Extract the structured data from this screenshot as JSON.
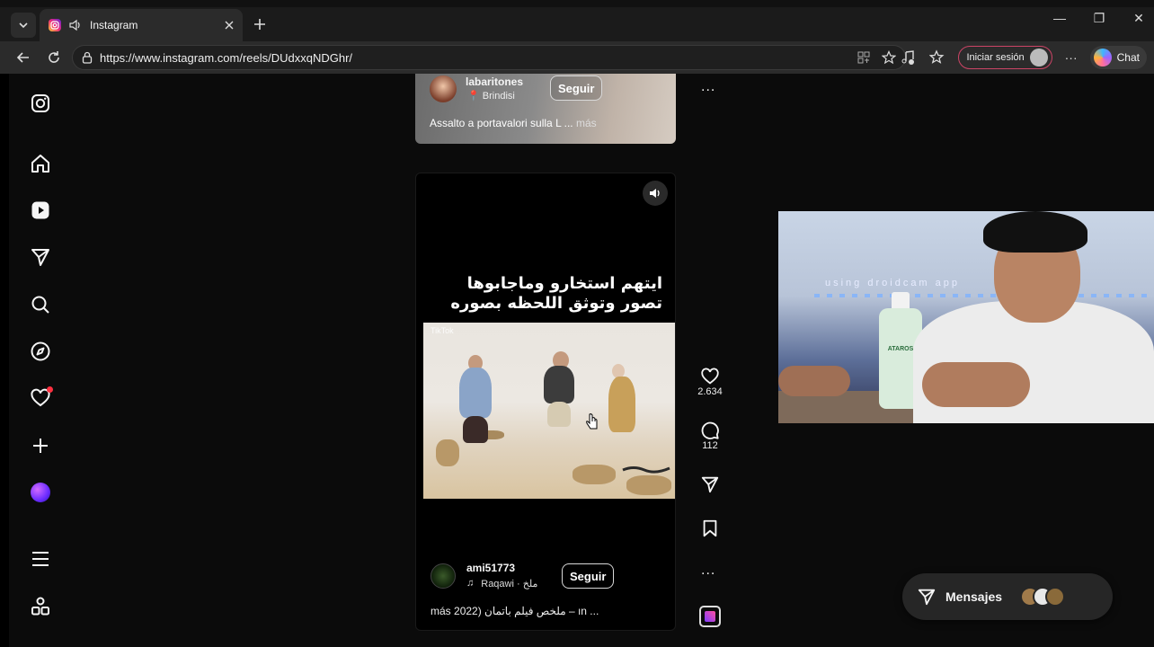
{
  "browser": {
    "tab_title": "Instagram",
    "url": "https://www.instagram.com/reels/DUdxxqNDGhr/",
    "signin_label": "Iniciar sesión",
    "chat_label": "Chat"
  },
  "sidebar": {
    "items": [
      "instagram-logo",
      "home",
      "reels",
      "messages",
      "search",
      "explore",
      "notifications",
      "create",
      "meta-ai",
      "more",
      "also-from-meta"
    ]
  },
  "prev_reel": {
    "username": "labaritones",
    "location": "Brindisi",
    "follow_label": "Seguir",
    "caption": "Assalto a portavalori sulla L ...",
    "more_label": "más"
  },
  "reel": {
    "overlay_line1": "ايتهم استخارو وماجابوها",
    "overlay_line2": "تصور وتوثق اللحظه بصوره",
    "watermark": "TikTok",
    "username": "ami51773",
    "follow_label": "Seguir",
    "audio": "Raqawi · ملخ",
    "caption": "ملخص فيلم باتمان (2022 – ın ...",
    "more_label": "más"
  },
  "actions": {
    "likes": "2.634",
    "comments": "112",
    "more": "..."
  },
  "webcam": {
    "overlay_text": "using droidcam app",
    "bottle_label": "ATAROS"
  },
  "messages": {
    "label": "Mensajes"
  },
  "colors": {
    "background": "#0b0b0b",
    "notification_dot": "#ff3040"
  }
}
